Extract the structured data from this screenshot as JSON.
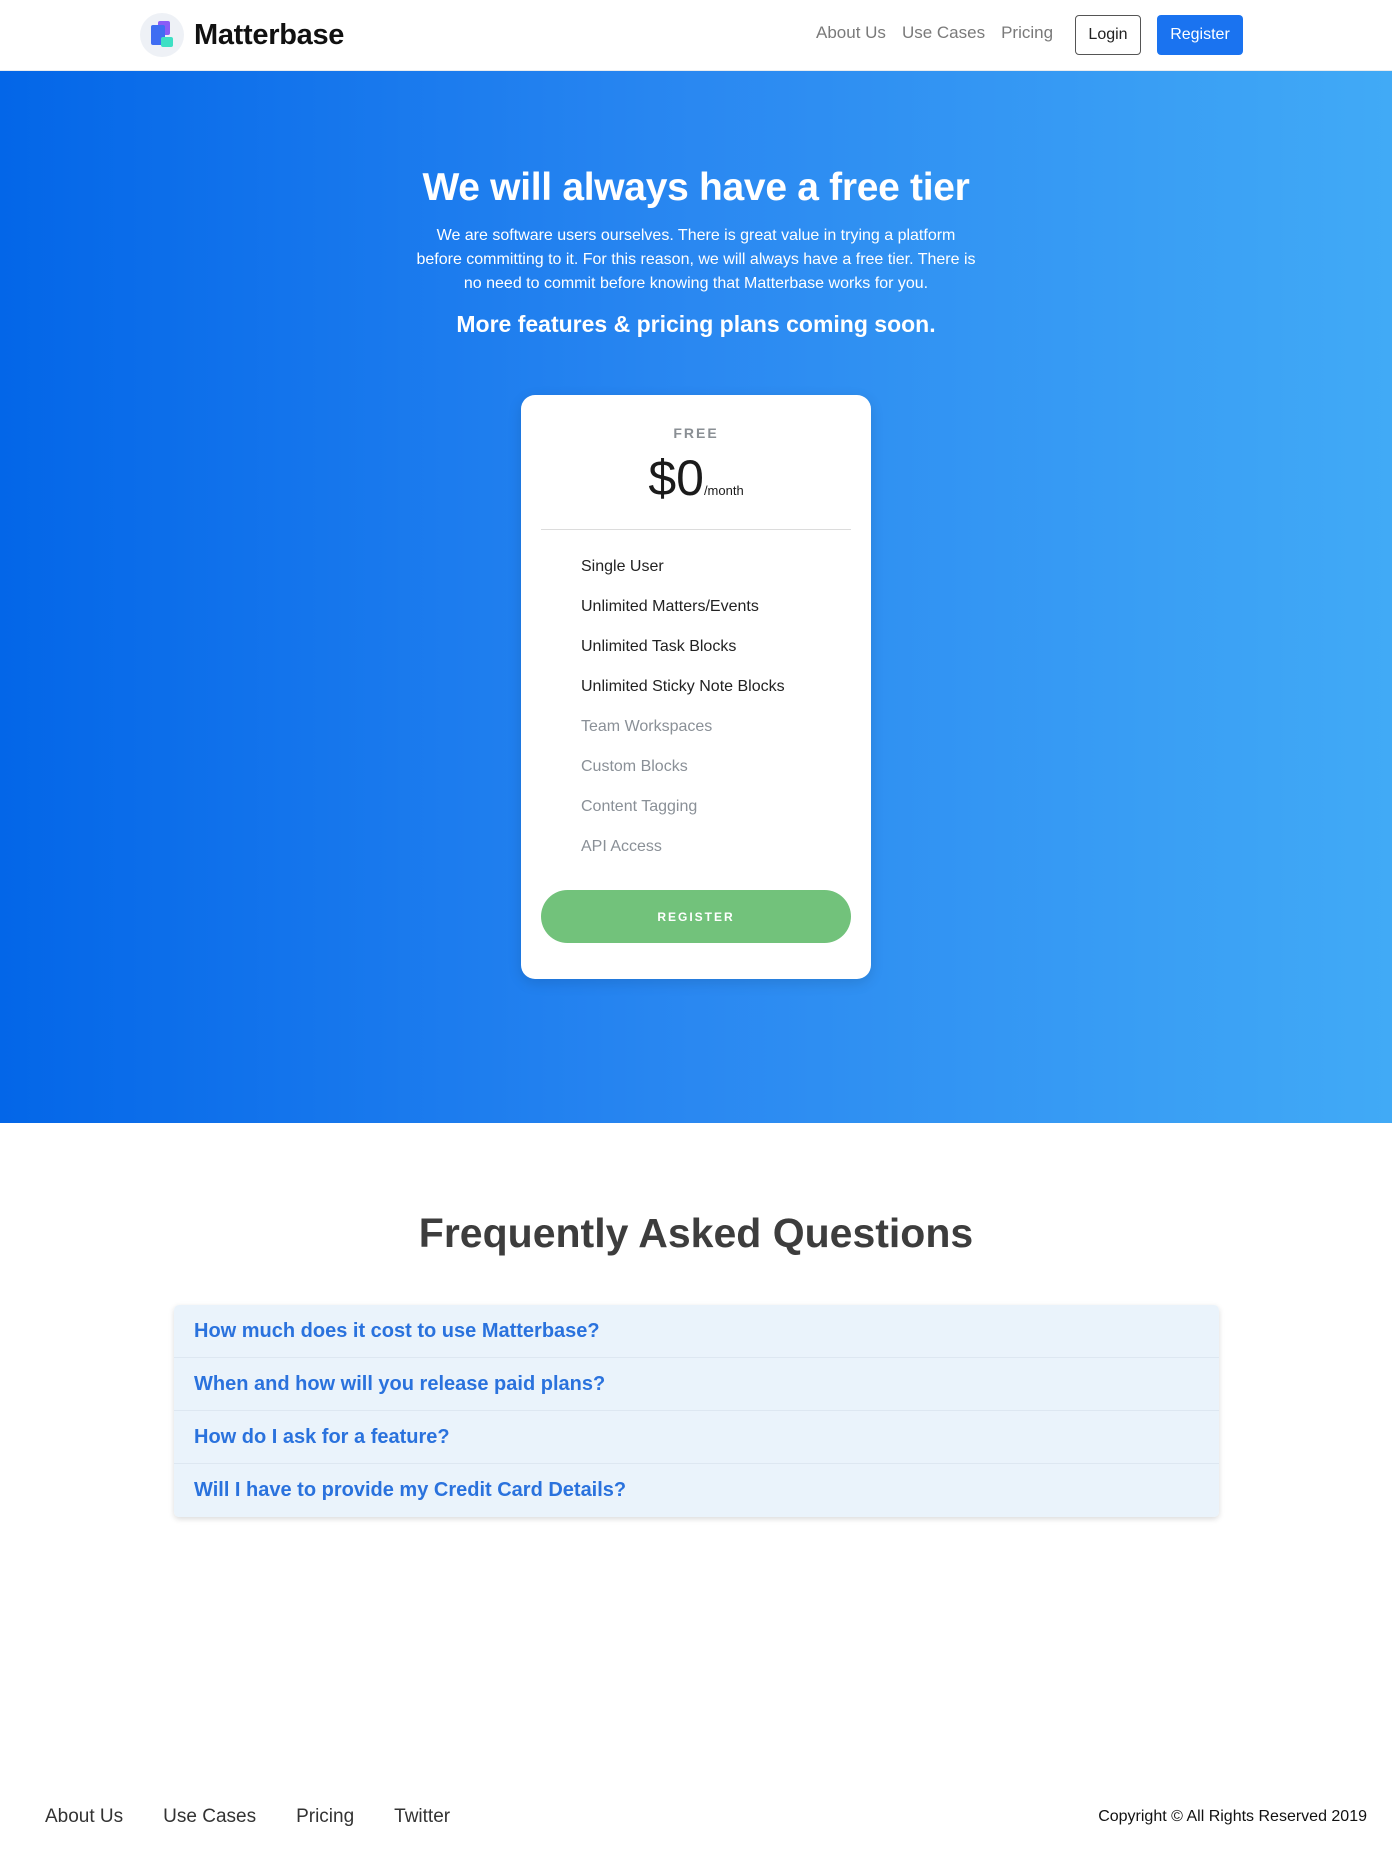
{
  "navbar": {
    "brand": "Matterbase",
    "links": [
      "About Us",
      "Use Cases",
      "Pricing"
    ],
    "login_label": "Login",
    "register_label": "Register"
  },
  "hero": {
    "title": "We will always have a free tier",
    "description": "We are software users ourselves. There is great value in trying a platform before committing to it. For this reason, we will always have a free tier. There is no need to commit before knowing that Matterbase works for you.",
    "subtitle": "More features & pricing plans coming soon."
  },
  "plan": {
    "tier": "FREE",
    "price": "$0",
    "period": "/month",
    "features": [
      {
        "label": "Single User",
        "included": true
      },
      {
        "label": "Unlimited Matters/Events",
        "included": true
      },
      {
        "label": "Unlimited Task Blocks",
        "included": true
      },
      {
        "label": "Unlimited Sticky Note Blocks",
        "included": true
      },
      {
        "label": "Team Workspaces",
        "included": false
      },
      {
        "label": "Custom Blocks",
        "included": false
      },
      {
        "label": "Content Tagging",
        "included": false
      },
      {
        "label": "API Access",
        "included": false
      }
    ],
    "register_label": "REGISTER"
  },
  "faq": {
    "title": "Frequently Asked Questions",
    "questions": [
      "How much does it cost to use Matterbase?",
      "When and how will you release paid plans?",
      "How do I ask for a feature?",
      "Will I have to provide my Credit Card Details?"
    ]
  },
  "footer": {
    "links": [
      "About Us",
      "Use Cases",
      "Pricing",
      "Twitter"
    ],
    "copyright": "Copyright © All Rights Reserved 2019"
  },
  "colors": {
    "primary": "#1a73f0",
    "hero_gradient_start": "#0366e8",
    "hero_gradient_end": "#41aaf6",
    "cta_green": "#72c27b",
    "faq_link": "#2a72dd"
  }
}
